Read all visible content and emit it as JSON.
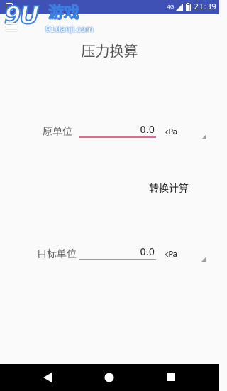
{
  "status_bar": {
    "signal_label": "4G",
    "time": "21:39",
    "icons": [
      "notification-icon",
      "signal-icon",
      "battery-icon"
    ]
  },
  "watermark": {
    "number": "9U",
    "name": "游戏",
    "url": "91danji.com"
  },
  "title": "压力换算",
  "source": {
    "label": "原单位",
    "value": "0.0",
    "unit": "kPa"
  },
  "convert_button": {
    "label": "转换计算"
  },
  "target": {
    "label": "目标单位",
    "value": "0.0",
    "unit": "kPa"
  },
  "colors": {
    "status_bar": "#3f51b5",
    "accent": "#e06a8c",
    "background": "#fafafa",
    "nav_bar": "#000000"
  },
  "nav_bar": {
    "buttons": [
      "back-icon",
      "home-icon",
      "recents-icon"
    ]
  }
}
